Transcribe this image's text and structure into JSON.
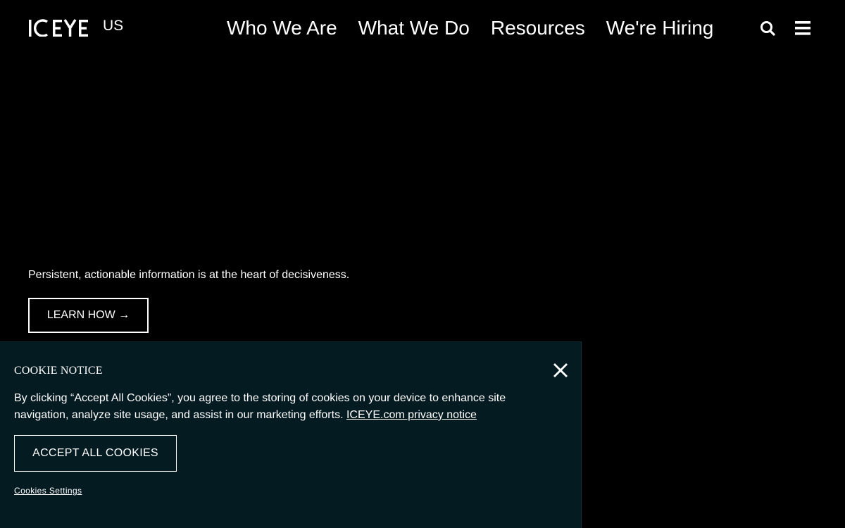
{
  "header": {
    "logo_text": "ICEYE",
    "logo_suffix": "US",
    "nav": [
      {
        "label": "Who We Are"
      },
      {
        "label": "What We Do"
      },
      {
        "label": "Resources"
      },
      {
        "label": "We're Hiring"
      }
    ],
    "search_icon": "search-icon",
    "menu_icon": "hamburger-menu-icon"
  },
  "hero": {
    "tagline": "Persistent, actionable information is at the heart of decisiveness.",
    "cta_label": "LEARN HOW →"
  },
  "cookie_notice": {
    "title": "COOKIE NOTICE",
    "body": "By clicking “Accept All Cookies”, you agree to the storing of cookies on your device to enhance site navigation, analyze site usage, and assist in our marketing efforts.",
    "privacy_link": "ICEYE.com privacy notice",
    "accept_label": "ACCEPT ALL COOKIES",
    "settings_label": "Cookies Settings",
    "close_icon": "close-icon"
  },
  "colors": {
    "background": "#000000",
    "banner_background": "#051b22",
    "text": "#ffffff"
  }
}
